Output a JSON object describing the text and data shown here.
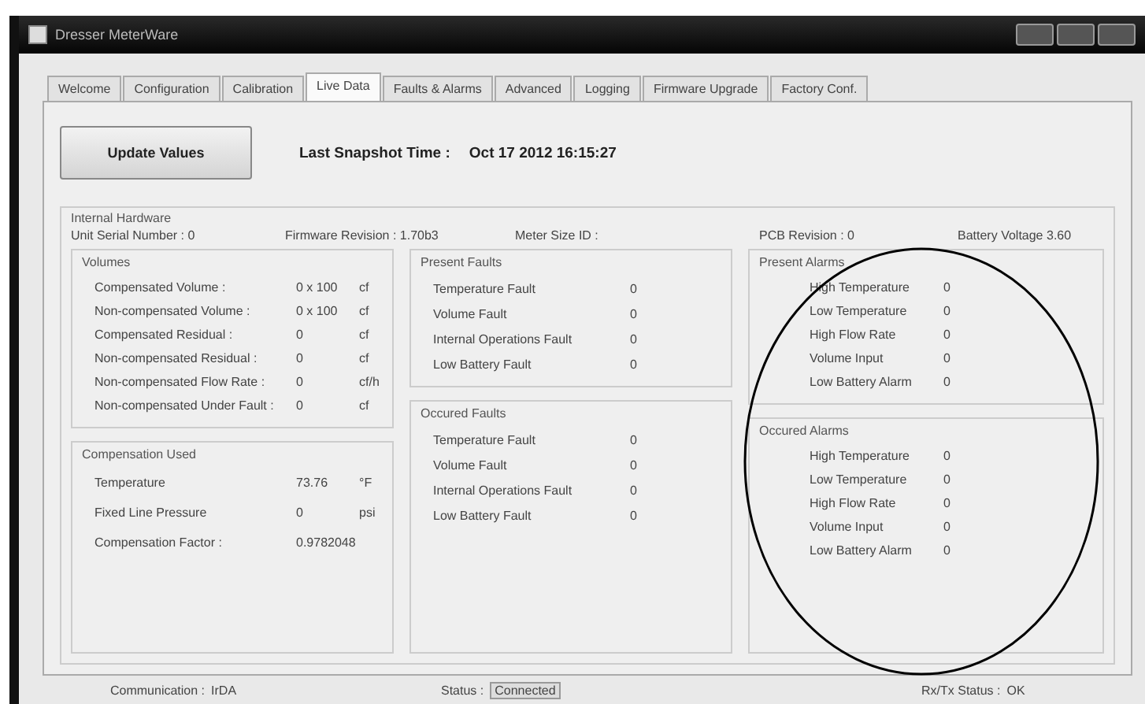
{
  "window": {
    "title": "Dresser MeterWare"
  },
  "tabs": [
    {
      "label": "Welcome",
      "selected": false
    },
    {
      "label": "Configuration",
      "selected": false
    },
    {
      "label": "Calibration",
      "selected": false
    },
    {
      "label": "Live Data",
      "selected": true
    },
    {
      "label": "Faults & Alarms",
      "selected": false
    },
    {
      "label": "Advanced",
      "selected": false
    },
    {
      "label": "Logging",
      "selected": false
    },
    {
      "label": "Firmware Upgrade",
      "selected": false
    },
    {
      "label": "Factory Conf.",
      "selected": false
    }
  ],
  "update_button": "Update Values",
  "snapshot": {
    "label": "Last Snapshot Time :",
    "value": "Oct 17 2012 16:15:27"
  },
  "internal_hardware": {
    "title": "Internal Hardware",
    "fields": [
      {
        "label": "Unit Serial Number :",
        "value": "0"
      },
      {
        "label": "Firmware Revision :",
        "value": "1.70b3"
      },
      {
        "label": "Meter Size ID :"
      },
      {
        "label": "PCB Revision :",
        "value": "0"
      },
      {
        "label": "Battery Voltage",
        "value": "3.60"
      }
    ]
  },
  "volumes": {
    "title": "Volumes",
    "rows": [
      {
        "label": "Compensated Volume :",
        "value": "0 x 100",
        "unit": "cf"
      },
      {
        "label": "Non-compensated Volume :",
        "value": "0 x 100",
        "unit": "cf"
      },
      {
        "label": "Compensated Residual :",
        "value": "0",
        "unit": "cf"
      },
      {
        "label": "Non-compensated Residual :",
        "value": "0",
        "unit": "cf"
      },
      {
        "label": "Non-compensated Flow Rate :",
        "value": "0",
        "unit": "cf/h"
      },
      {
        "label": "Non-compensated Under Fault :",
        "value": "0",
        "unit": "cf"
      }
    ]
  },
  "compensation": {
    "title": "Compensation Used",
    "rows": [
      {
        "label": "Temperature",
        "value": "73.76",
        "unit": "°F"
      },
      {
        "label": "Fixed Line Pressure",
        "value": "0",
        "unit": "psi"
      },
      {
        "label": "Compensation Factor :",
        "value": "0.9782048"
      }
    ]
  },
  "present_faults": {
    "title": "Present Faults",
    "rows": [
      {
        "label": "Temperature Fault",
        "value": "0"
      },
      {
        "label": "Volume Fault",
        "value": "0"
      },
      {
        "label": "Internal Operations Fault",
        "value": "0"
      },
      {
        "label": "Low Battery Fault",
        "value": "0"
      }
    ]
  },
  "occurred_faults": {
    "title": "Occured Faults",
    "rows": [
      {
        "label": "Temperature Fault",
        "value": "0"
      },
      {
        "label": "Volume Fault",
        "value": "0"
      },
      {
        "label": "Internal Operations Fault",
        "value": "0"
      },
      {
        "label": "Low Battery Fault",
        "value": "0"
      }
    ]
  },
  "present_alarms": {
    "title": "Present Alarms",
    "rows": [
      {
        "label": "High Temperature",
        "value": "0"
      },
      {
        "label": "Low Temperature",
        "value": "0"
      },
      {
        "label": "High Flow Rate",
        "value": "0"
      },
      {
        "label": "Volume Input",
        "value": "0"
      },
      {
        "label": "Low Battery Alarm",
        "value": "0"
      }
    ]
  },
  "occurred_alarms": {
    "title": "Occured Alarms",
    "rows": [
      {
        "label": "High Temperature",
        "value": "0"
      },
      {
        "label": "Low Temperature",
        "value": "0"
      },
      {
        "label": "High Flow Rate",
        "value": "0"
      },
      {
        "label": "Volume Input",
        "value": "0"
      },
      {
        "label": "Low Battery Alarm",
        "value": "0"
      }
    ]
  },
  "status_bar": [
    {
      "label": "Communication :",
      "value": "IrDA",
      "highlighted": false
    },
    {
      "label": "Status :",
      "value": "Connected",
      "highlighted": true
    },
    {
      "label": "Rx/Tx Status :",
      "value": "OK",
      "highlighted": false
    }
  ]
}
